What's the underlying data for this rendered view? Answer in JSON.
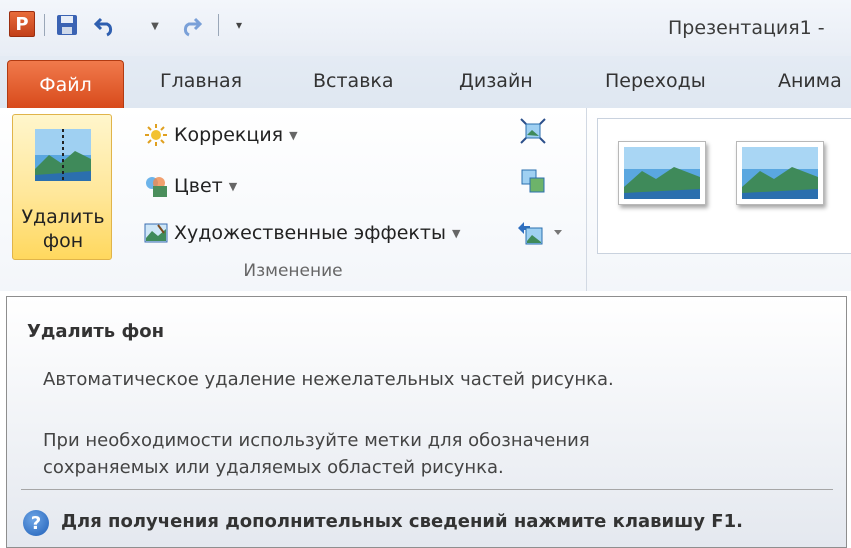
{
  "window": {
    "title": "Презентация1 -"
  },
  "qat": {
    "app_logo": "P",
    "buttons": [
      "save-icon",
      "undo-icon",
      "undo-dropdown-icon",
      "redo-icon",
      "customize-qat-icon"
    ]
  },
  "tabs": [
    {
      "label": "Файл",
      "active": true
    },
    {
      "label": "Главная"
    },
    {
      "label": "Вставка"
    },
    {
      "label": "Дизайн"
    },
    {
      "label": "Переходы"
    },
    {
      "label": "Анима"
    }
  ],
  "ribbon": {
    "adjust_group": {
      "label": "Изменение",
      "remove_background": {
        "line1": "Удалить",
        "line2": "фон"
      },
      "corrections": "Коррекция",
      "color": "Цвет",
      "artistic_effects": "Художественные эффекты",
      "side_icons": [
        "compress-pictures-icon",
        "change-picture-icon",
        "reset-picture-icon"
      ]
    }
  },
  "tooltip": {
    "title": "Удалить фон",
    "description1": "Автоматическое удаление нежелательных частей рисунка.",
    "description2_line1": "При необходимости используйте метки для обозначения",
    "description2_line2": "сохраняемых или удаляемых областей рисунка.",
    "help_text": "Для получения дополнительных сведений нажмите клавишу F1."
  },
  "colors": {
    "file_tab": "#d84a1b",
    "highlight": "#ffe79a",
    "help_icon": "#1f5fb8"
  }
}
